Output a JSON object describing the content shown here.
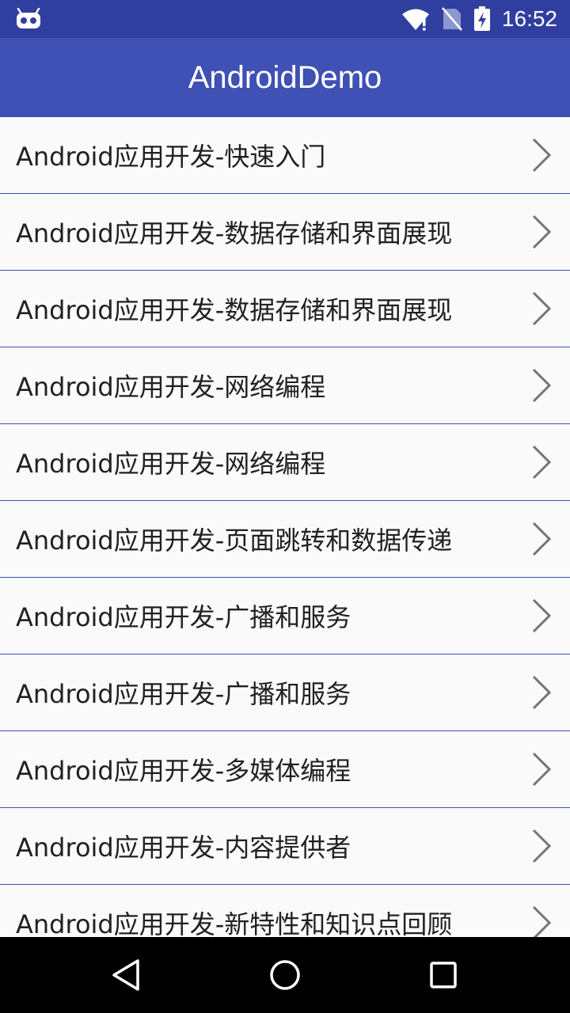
{
  "status_bar": {
    "time": "16:52",
    "icons": [
      "robot-icon",
      "wifi-icon",
      "no-sim-icon",
      "battery-charging-icon"
    ]
  },
  "app_bar": {
    "title": "AndroidDemo"
  },
  "list": {
    "items": [
      {
        "label": "Android应用开发-快速入门"
      },
      {
        "label": "Android应用开发-数据存储和界面展现"
      },
      {
        "label": "Android应用开发-数据存储和界面展现"
      },
      {
        "label": "Android应用开发-网络编程"
      },
      {
        "label": "Android应用开发-网络编程"
      },
      {
        "label": "Android应用开发-页面跳转和数据传递"
      },
      {
        "label": "Android应用开发-广播和服务"
      },
      {
        "label": "Android应用开发-广播和服务"
      },
      {
        "label": "Android应用开发-多媒体编程"
      },
      {
        "label": "Android应用开发-内容提供者"
      },
      {
        "label": "Android应用开发-新特性和知识点回顾"
      }
    ]
  },
  "nav_bar": {
    "buttons": [
      "back-icon",
      "home-icon",
      "recents-icon"
    ]
  },
  "colors": {
    "status_bar": "#303f9f",
    "app_bar": "#3f51b5",
    "divider": "#3f51b5",
    "background": "#fafafa",
    "text": "#212121",
    "chevron": "#757575"
  }
}
